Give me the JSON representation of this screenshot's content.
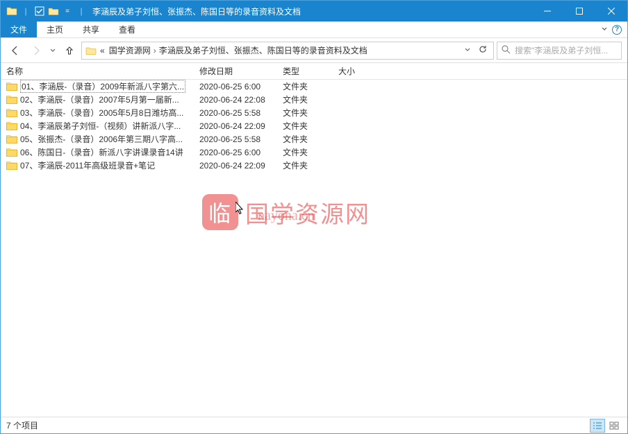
{
  "window": {
    "title": "李涵辰及弟子刘恒、张振杰、陈国日等的录音资料及文档"
  },
  "ribbon": {
    "file": "文件",
    "home": "主页",
    "share": "共享",
    "view": "查看"
  },
  "breadcrumb": {
    "prefix": "«",
    "items": [
      "国学资源网",
      "李涵辰及弟子刘恒、张振杰、陈国日等的录音资料及文档"
    ]
  },
  "search": {
    "placeholder": "搜索\"李涵辰及弟子刘恒..."
  },
  "columns": {
    "name": "名称",
    "date": "修改日期",
    "type": "类型",
    "size": "大小"
  },
  "files": [
    {
      "name": "01、李涵辰-（录音）2009年新派八字第六...",
      "date": "2020-06-25 6:00",
      "type": "文件夹",
      "selected": true
    },
    {
      "name": "02、李涵辰-（录音）2007年5月第一届新...",
      "date": "2020-06-24 22:08",
      "type": "文件夹"
    },
    {
      "name": "03、李涵辰-（录音）2005年5月8日潍坊高...",
      "date": "2020-06-25 5:58",
      "type": "文件夹"
    },
    {
      "name": "04、李涵辰弟子刘恒-（视频）讲新派八字...",
      "date": "2020-06-24 22:09",
      "type": "文件夹"
    },
    {
      "name": "05、张振杰-（录音）2006年第三期八字高...",
      "date": "2020-06-25 5:58",
      "type": "文件夹"
    },
    {
      "name": "06、陈国日-（录音）新派八字讲课录音14讲",
      "date": "2020-06-25 6:00",
      "type": "文件夹"
    },
    {
      "name": "07、李涵辰-2011年高级班录音+笔记",
      "date": "2020-06-24 22:09",
      "type": "文件夹"
    }
  ],
  "watermark": {
    "stamp": "临",
    "text": "国学资源网",
    "sub": "nayona.cn"
  },
  "status": {
    "count": "7 个项目"
  }
}
